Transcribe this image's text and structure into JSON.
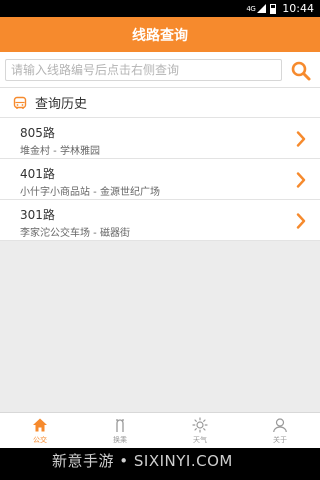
{
  "status": {
    "signal": "4G",
    "time": "10:44"
  },
  "title": "线路查询",
  "search": {
    "placeholder": "请输入线路编号后点击右侧查询",
    "value": ""
  },
  "history": {
    "title": "查询历史",
    "items": [
      {
        "route": "805路",
        "stops": "堆金村 - 学林雅园"
      },
      {
        "route": "401路",
        "stops": "小什字小商品站 - 金源世纪广场"
      },
      {
        "route": "301路",
        "stops": "李家沱公交车场 - 磁器街"
      }
    ]
  },
  "tabs": [
    {
      "label": "公交",
      "icon": "home-icon",
      "active": true
    },
    {
      "label": "换乘",
      "icon": "transfer-icon",
      "active": false
    },
    {
      "label": "天气",
      "icon": "sun-icon",
      "active": false
    },
    {
      "label": "关于",
      "icon": "person-icon",
      "active": false
    }
  ],
  "watermark": "新意手游 • SIXINYI.COM",
  "colors": {
    "accent": "#f68a2d",
    "background": "#ececec"
  }
}
